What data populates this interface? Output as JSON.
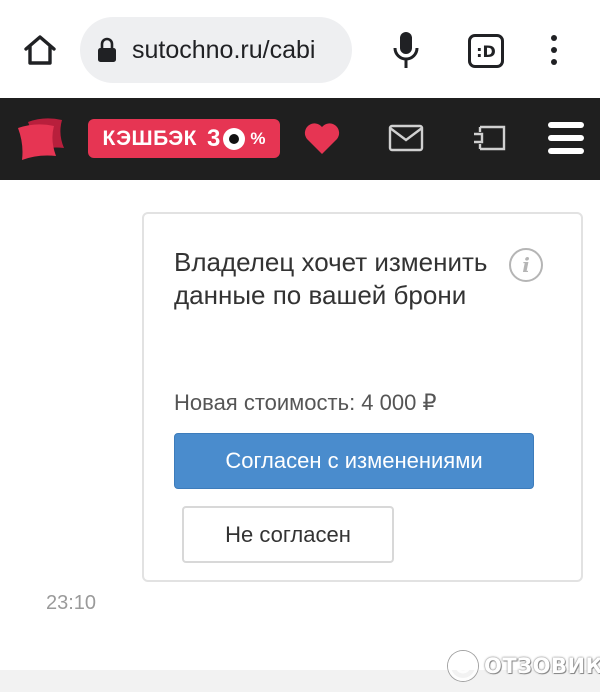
{
  "browser": {
    "url": "sutochno.ru/cabi",
    "tabs_label": ":D"
  },
  "site_header": {
    "cashback_label": "КЭШБЭК",
    "cashback_value_prefix": "3",
    "cashback_percent": "%",
    "brand_color": "#e63553",
    "header_bg": "#1f1f1f"
  },
  "request_card": {
    "title": "Владелец хочет изменить данные по вашей брони",
    "price_text": "Новая стоимость: 4 000 ₽",
    "agree_label": "Согласен с изменениями",
    "disagree_label": "Не согласен",
    "agree_color": "#4a8ccd"
  },
  "message": {
    "time": "23:10"
  },
  "watermark": {
    "text": "ОТЗОВИК"
  }
}
